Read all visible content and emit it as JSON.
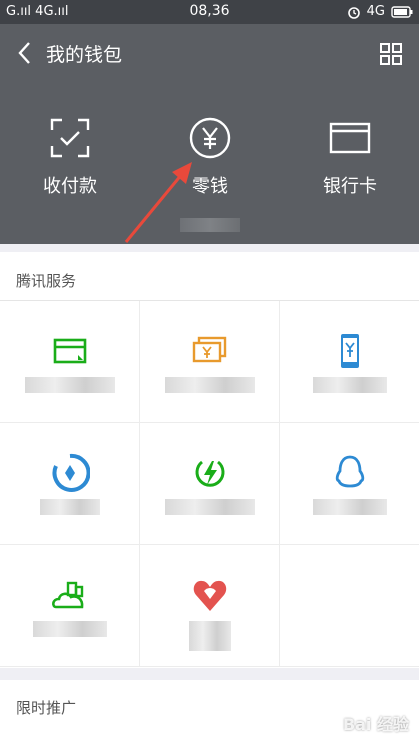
{
  "status_bar": {
    "left": "G.ııl 4G.ııl",
    "time": "08,36",
    "right": "4G"
  },
  "header": {
    "title": "我的钱包",
    "items": [
      {
        "label": "收付款",
        "icon": "scan-pay-icon"
      },
      {
        "label": "零钱",
        "icon": "yuan-coin-icon"
      },
      {
        "label": "银行卡",
        "icon": "bank-card-icon"
      }
    ]
  },
  "sections": {
    "tencent_services": "腾讯服务",
    "limited_promo": "限时推广"
  },
  "colors": {
    "header_bg": "#5b5e63",
    "status_bg": "#3f4247",
    "green": "#1aad19",
    "orange": "#e89a2d",
    "blue": "#2d8ad3",
    "red": "#e3534f",
    "arrow": "#e8493b"
  },
  "watermark": "Bai 经验"
}
